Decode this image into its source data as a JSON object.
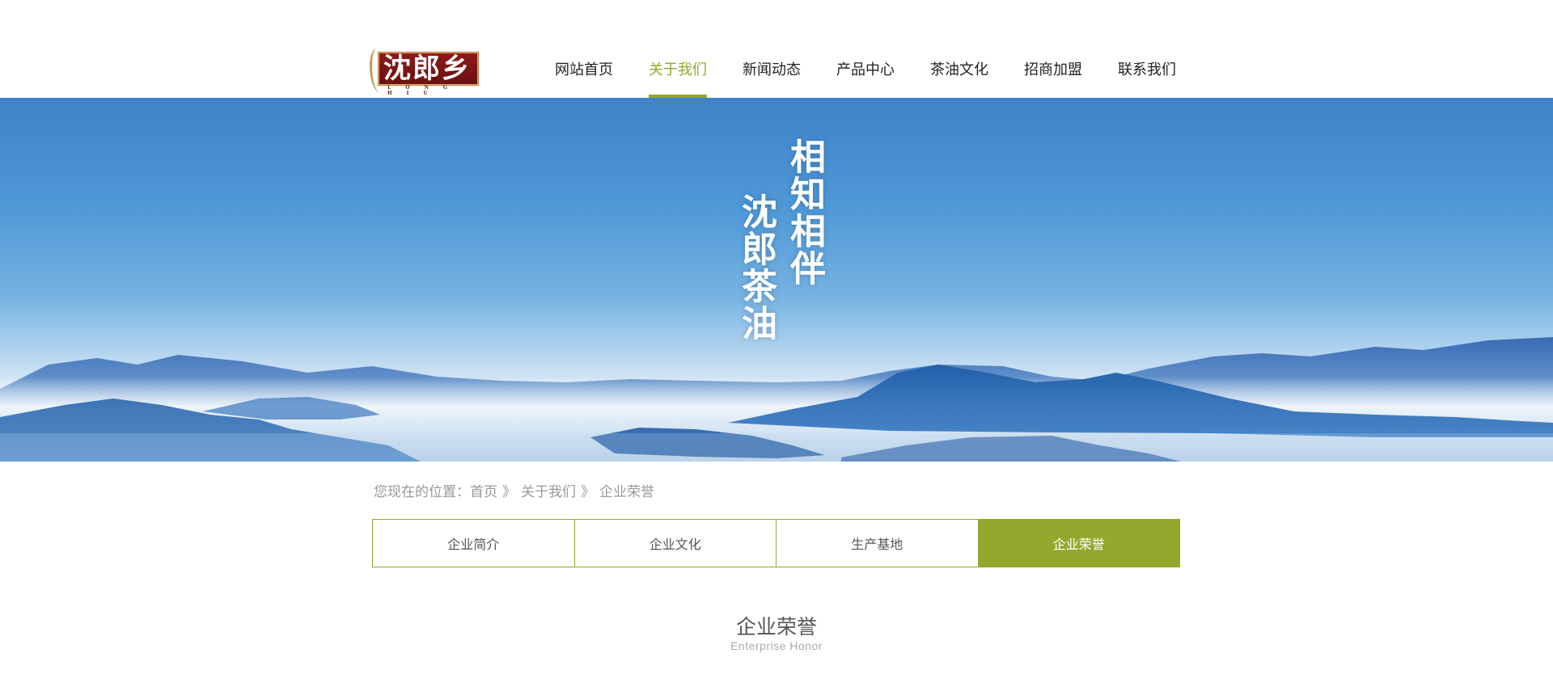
{
  "logo": {
    "text": "沈郎乡",
    "sub": "SIM LONG HIU"
  },
  "nav": {
    "items": [
      {
        "label": "网站首页",
        "active": false
      },
      {
        "label": "关于我们",
        "active": true
      },
      {
        "label": "新闻动态",
        "active": false
      },
      {
        "label": "产品中心",
        "active": false
      },
      {
        "label": "茶油文化",
        "active": false
      },
      {
        "label": "招商加盟",
        "active": false
      },
      {
        "label": "联系我们",
        "active": false
      }
    ]
  },
  "banner": {
    "line1": "相知相伴",
    "line2": "沈郎茶油"
  },
  "breadcrumb": {
    "prefix": "您现在的位置：",
    "items": [
      "首页",
      "关于我们",
      "企业荣誉"
    ],
    "separator": "》"
  },
  "subtabs": {
    "items": [
      {
        "label": "企业简介",
        "active": false
      },
      {
        "label": "企业文化",
        "active": false
      },
      {
        "label": "生产基地",
        "active": false
      },
      {
        "label": "企业荣誉",
        "active": true
      }
    ]
  },
  "section": {
    "title": "企业荣誉",
    "subtitle": "Enterprise  Honor"
  },
  "colors": {
    "accent": "#95a82d",
    "banner_sky": "#4f98d6"
  }
}
